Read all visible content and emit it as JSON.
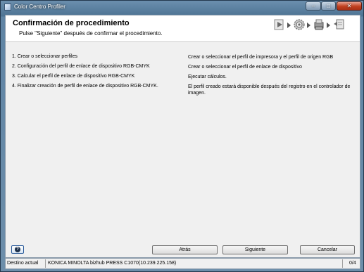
{
  "window": {
    "title": "Color Centro Profiler",
    "controls": {
      "minimize": "–",
      "maximize": "□",
      "close": "✕"
    }
  },
  "header": {
    "title": "Confirmación de procedimiento",
    "subtitle": "Pulse \"Siguiente\" después de confirmar el procedimiento.",
    "step_icons": [
      "play-step-icon",
      "gear-step-icon",
      "printer-step-icon",
      "profile-step-icon"
    ]
  },
  "steps": [
    {
      "left": "1. Crear o seleccionar perfiles",
      "right": "Crear o seleccionar el perfil de impresora y el perfil de origen RGB"
    },
    {
      "left": "2. Configuración del perfil de enlace de dispositivo RGB-CMYK",
      "right": "Crear o seleccionar el perfil de enlace de dispositivo"
    },
    {
      "left": "3. Calcular el perfil de enlace de dispositivo RGB-CMYK",
      "right": "Ejecutar cálculos."
    },
    {
      "left": "4. Finalizar creación de perfil de enlace de dispositivo RGB-CMYK.",
      "right": "El perfil creado estará disponible después del registro en el controlador de imagen."
    }
  ],
  "footer": {
    "help": "?",
    "back": "Atrás",
    "next": "Siguiente",
    "cancel": "Cancelar"
  },
  "statusbar": {
    "label": "Destino actual",
    "device": "KONICA MINOLTA bizhub PRESS C1070(10.239.225.158)",
    "count": "0/4"
  }
}
